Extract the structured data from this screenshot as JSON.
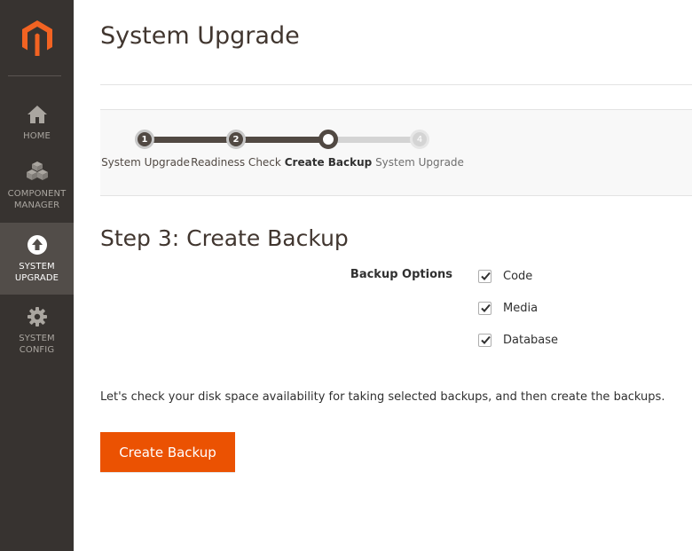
{
  "sidebar": {
    "logo_icon": "magento-logo-icon",
    "items": [
      {
        "id": "home",
        "label": "HOME",
        "icon": "home-icon",
        "active": false
      },
      {
        "id": "component-manager",
        "label": "COMPONENT MANAGER",
        "icon": "cubes-icon",
        "active": false
      },
      {
        "id": "system-upgrade",
        "label": "SYSTEM UPGRADE",
        "icon": "upgrade-arrow-icon",
        "active": true
      },
      {
        "id": "system-config",
        "label": "SYSTEM CONFIG",
        "icon": "gear-icon",
        "active": false
      }
    ]
  },
  "page": {
    "title": "System Upgrade"
  },
  "progress": {
    "steps": [
      {
        "number": "1",
        "label": "System Upgrade",
        "state": "done"
      },
      {
        "number": "2",
        "label": "Readiness Check",
        "state": "done"
      },
      {
        "number": "3",
        "label": "Create Backup",
        "state": "current"
      },
      {
        "number": "4",
        "label": "System Upgrade",
        "state": "todo"
      }
    ]
  },
  "step": {
    "heading": "Step 3: Create Backup",
    "options_label": "Backup Options",
    "options": [
      {
        "label": "Code",
        "checked": true
      },
      {
        "label": "Media",
        "checked": true
      },
      {
        "label": "Database",
        "checked": true
      }
    ],
    "info_text": "Let's check your disk space availability for taking selected backups, and then create the backups.",
    "create_button": "Create Backup"
  },
  "colors": {
    "sidebar_bg": "#373330",
    "sidebar_active_bg": "#524d49",
    "brand_orange": "#eb5202",
    "progress_done": "#514943"
  }
}
